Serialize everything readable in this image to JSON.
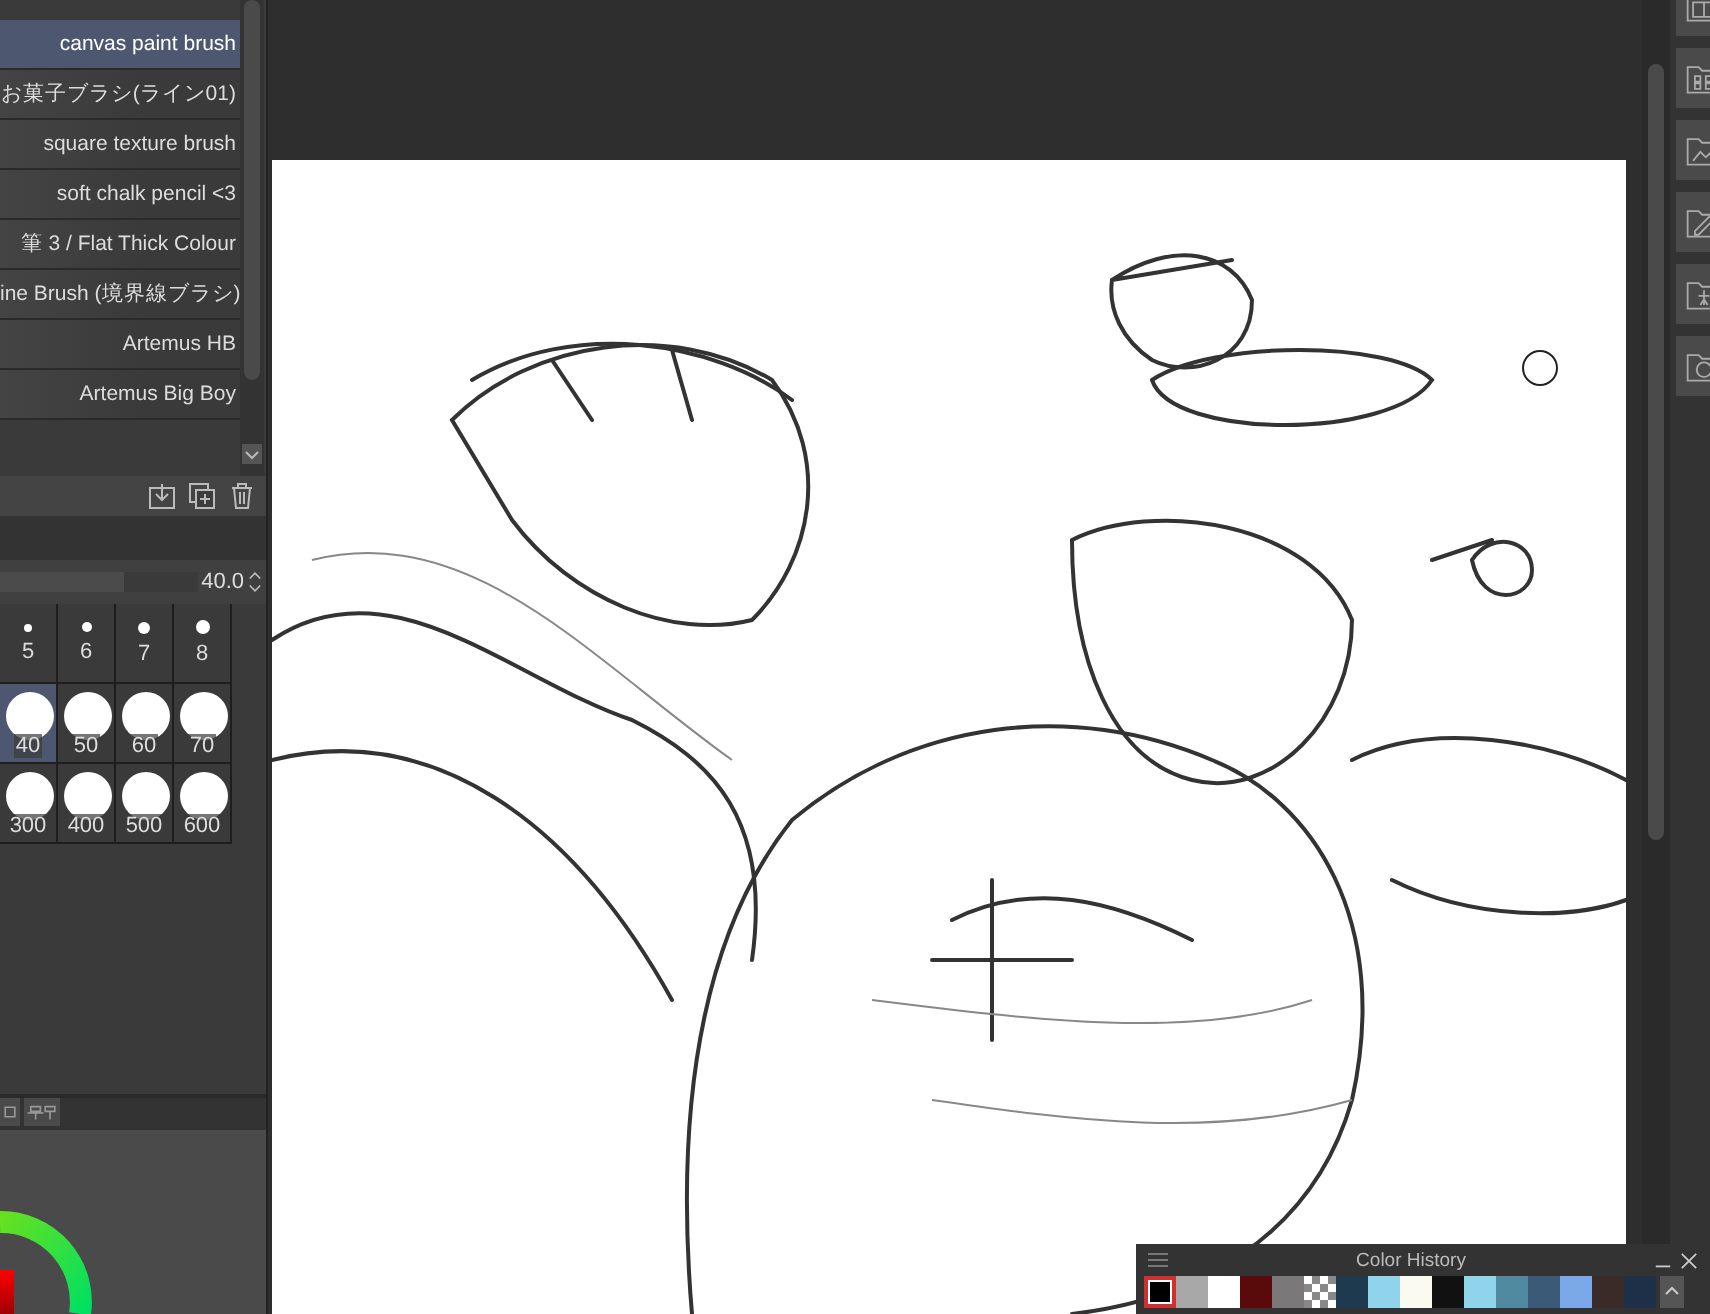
{
  "brush_list": {
    "items": [
      {
        "label": "canvas paint brush",
        "selected": true
      },
      {
        "label": "お菓子ブラシ(ライン01)",
        "selected": false
      },
      {
        "label": "square texture brush",
        "selected": false
      },
      {
        "label": "soft chalk pencil <3",
        "selected": false
      },
      {
        "label": "筆 3 / Flat Thick Colour",
        "selected": false
      },
      {
        "label": "ine Brush (境界線ブラシ)",
        "selected": false
      },
      {
        "label": "Artemus HB",
        "selected": false
      },
      {
        "label": "Artemus Big Boy",
        "selected": false
      }
    ]
  },
  "brush_size": {
    "value": "40.0",
    "level": 0.63
  },
  "size_presets": [
    {
      "label": "5",
      "kind": "dot",
      "selected": false
    },
    {
      "label": "6",
      "kind": "dot",
      "selected": false
    },
    {
      "label": "7",
      "kind": "dot",
      "selected": false
    },
    {
      "label": "8",
      "kind": "dot",
      "selected": false
    },
    {
      "label": "40",
      "kind": "circle",
      "selected": true
    },
    {
      "label": "50",
      "kind": "circle",
      "selected": false
    },
    {
      "label": "60",
      "kind": "circle",
      "selected": false
    },
    {
      "label": "70",
      "kind": "circle",
      "selected": false
    },
    {
      "label": "300",
      "kind": "circle",
      "selected": false
    },
    {
      "label": "400",
      "kind": "circle",
      "selected": false
    },
    {
      "label": "500",
      "kind": "circle",
      "selected": false
    },
    {
      "label": "600",
      "kind": "circle",
      "selected": false
    }
  ],
  "color_history": {
    "title": "Color History",
    "swatches": [
      {
        "kind": "color",
        "color": "#000000",
        "selected": true
      },
      {
        "kind": "color",
        "color": "#a8a8a8",
        "selected": false
      },
      {
        "kind": "color",
        "color": "#ffffff",
        "selected": false
      },
      {
        "kind": "color",
        "color": "#5a0a0a",
        "selected": false
      },
      {
        "kind": "color",
        "color": "#7a7878",
        "selected": false
      },
      {
        "kind": "transparent",
        "selected": false
      },
      {
        "kind": "color",
        "color": "#1e3a4e",
        "selected": false
      },
      {
        "kind": "color",
        "color": "#8fd4ea",
        "selected": false
      },
      {
        "kind": "color",
        "color": "#fafaf0",
        "selected": false
      },
      {
        "kind": "color",
        "color": "#111111",
        "selected": false
      },
      {
        "kind": "color",
        "color": "#8fd4ea",
        "selected": false
      },
      {
        "kind": "color",
        "color": "#4f8aa0",
        "selected": false
      },
      {
        "kind": "color",
        "color": "#3a5a78",
        "selected": false
      },
      {
        "kind": "color",
        "color": "#7aa8e8",
        "selected": false
      },
      {
        "kind": "color",
        "color": "#3a2a28",
        "selected": false
      },
      {
        "kind": "color",
        "color": "#1e3048",
        "selected": false
      }
    ]
  }
}
